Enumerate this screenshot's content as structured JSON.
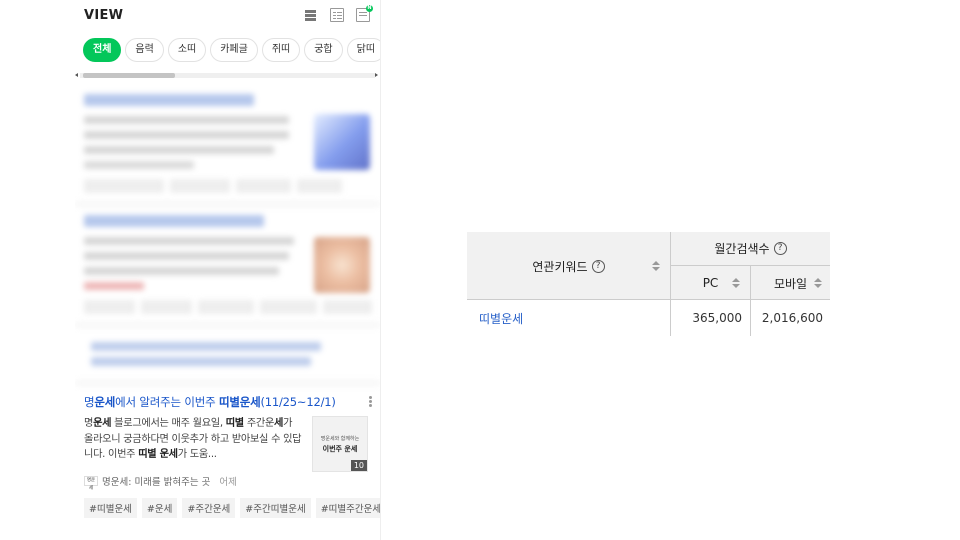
{
  "view": {
    "title": "VIEW",
    "notification_badge": "N",
    "chips": [
      "전체",
      "음력",
      "소띠",
      "카페글",
      "쥐띠",
      "궁합",
      "닭띠"
    ]
  },
  "result": {
    "title_prefix": "명",
    "title_hl1": "운세",
    "title_mid": "에서 알려주는 이번주 ",
    "title_hl2": "띠별운세",
    "title_suffix": "(11/25~12/1)",
    "snippet": [
      {
        "t": "명",
        "b": false
      },
      {
        "t": "운세",
        "b": true
      },
      {
        "t": " 블로그에서는 매주 월요일, ",
        "b": false
      },
      {
        "t": "띠별",
        "b": true
      },
      {
        "t": " 주간운",
        "b": false
      },
      {
        "t": "세",
        "b": true
      },
      {
        "t": "가 올라오니 궁금하다면 이웃추가 하고 받아보실 수 있답니다. 이번주 ",
        "b": false
      },
      {
        "t": "띠별 운세",
        "b": true
      },
      {
        "t": "가 도움...",
        "b": false
      }
    ],
    "thumb_small": "명운세와 함께하는",
    "thumb_large": "이번주 운세",
    "thumb_count": "10",
    "source_logo": "명운세",
    "source": "명운세: 미래를 밝혀주는 곳",
    "time": "어제",
    "tags": [
      "#띠별운세",
      "#운세",
      "#주간운세",
      "#주간띠별운세",
      "#띠별주간운세"
    ]
  },
  "keyword_table": {
    "col_keyword": "연관키워드",
    "col_monthly": "월간검색수",
    "col_pc": "PC",
    "col_mobile": "모바일",
    "help_icon": "?",
    "rows": [
      {
        "keyword": "띠별운세",
        "pc": "365,000",
        "mobile": "2,016,600"
      }
    ]
  },
  "colors": {
    "accent_green": "#03c75a",
    "link_blue": "#1a56c9",
    "table_header_bg": "#f1f1f1"
  }
}
